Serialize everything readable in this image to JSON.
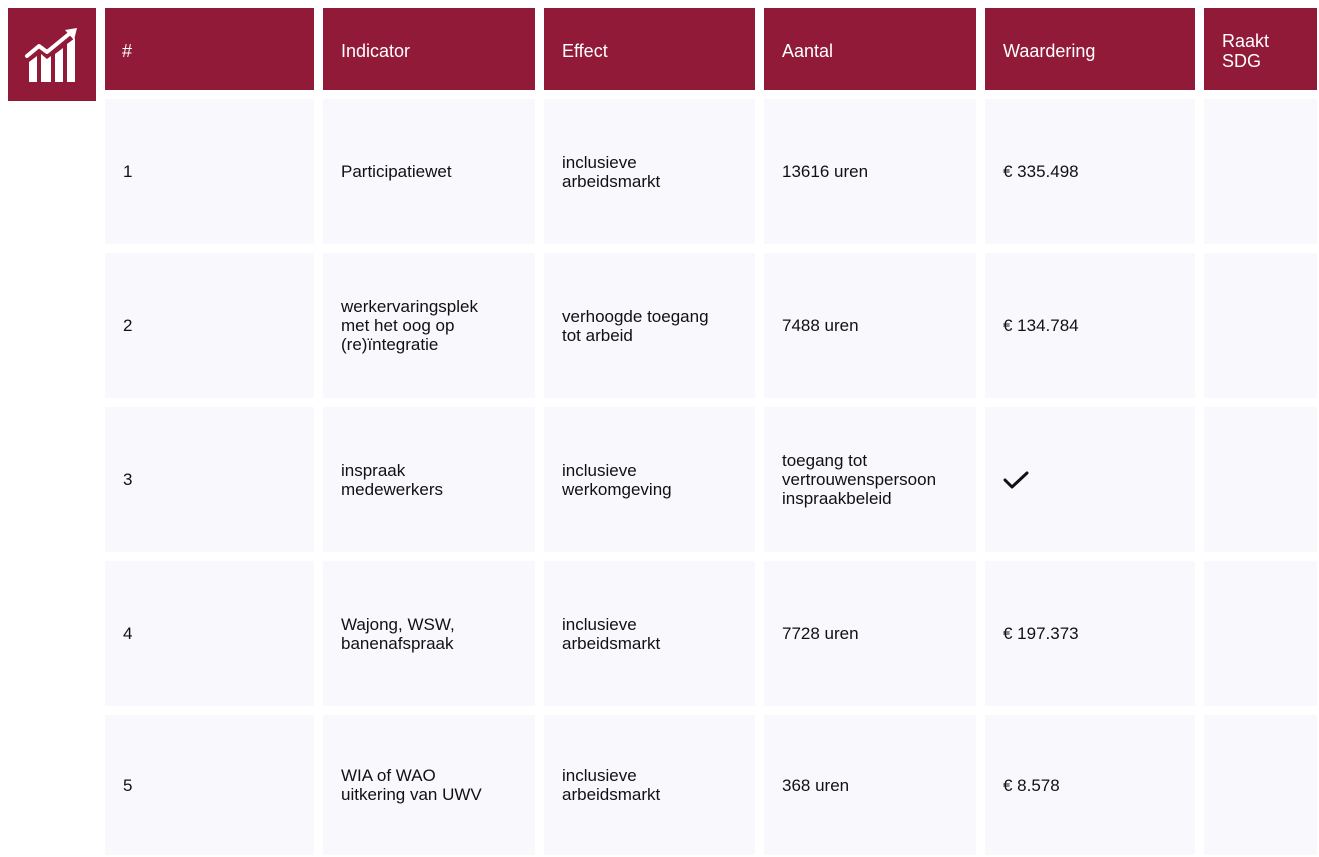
{
  "logo": {
    "icon": "growth-chart-icon",
    "color": "#911a38"
  },
  "columns": [
    "#",
    "Indicator",
    "Effect",
    "Aantal",
    "Waardering",
    "Raakt\nSDG"
  ],
  "rows": [
    {
      "num": "1",
      "indicator": "Participatiewet",
      "effect": "inclusieve\narbeidsmarkt",
      "aantal": "13616 uren",
      "waardering": "€ 335.498",
      "sdg": ""
    },
    {
      "num": "2",
      "indicator": "werkervaringsplek\nmet het oog op\n(re)ïntegratie",
      "effect": "verhoogde toegang\ntot arbeid",
      "aantal": "7488 uren",
      "waardering": "€ 134.784",
      "sdg": ""
    },
    {
      "num": "3",
      "indicator": "inspraak\nmedewerkers",
      "effect": "inclusieve\nwerkomgeving",
      "aantal": "toegang tot\nvertrouwenspersoon\ninspraakbeleid",
      "waardering": "",
      "waardering_icon": "checkmark-icon",
      "sdg": ""
    },
    {
      "num": "4",
      "indicator": "Wajong, WSW,\nbanenafspraak",
      "effect": "inclusieve\narbeidsmarkt",
      "aantal": "7728 uren",
      "waardering": "€ 197.373",
      "sdg": ""
    },
    {
      "num": "5",
      "indicator": "WIA of WAO\nuitkering van UWV",
      "effect": "inclusieve\narbeidsmarkt",
      "aantal": "368 uren",
      "waardering": "€ 8.578",
      "sdg": ""
    }
  ],
  "colors": {
    "header_bg": "#911a38",
    "cell_bg": "#f8f8fd",
    "header_text": "#ffffff"
  }
}
